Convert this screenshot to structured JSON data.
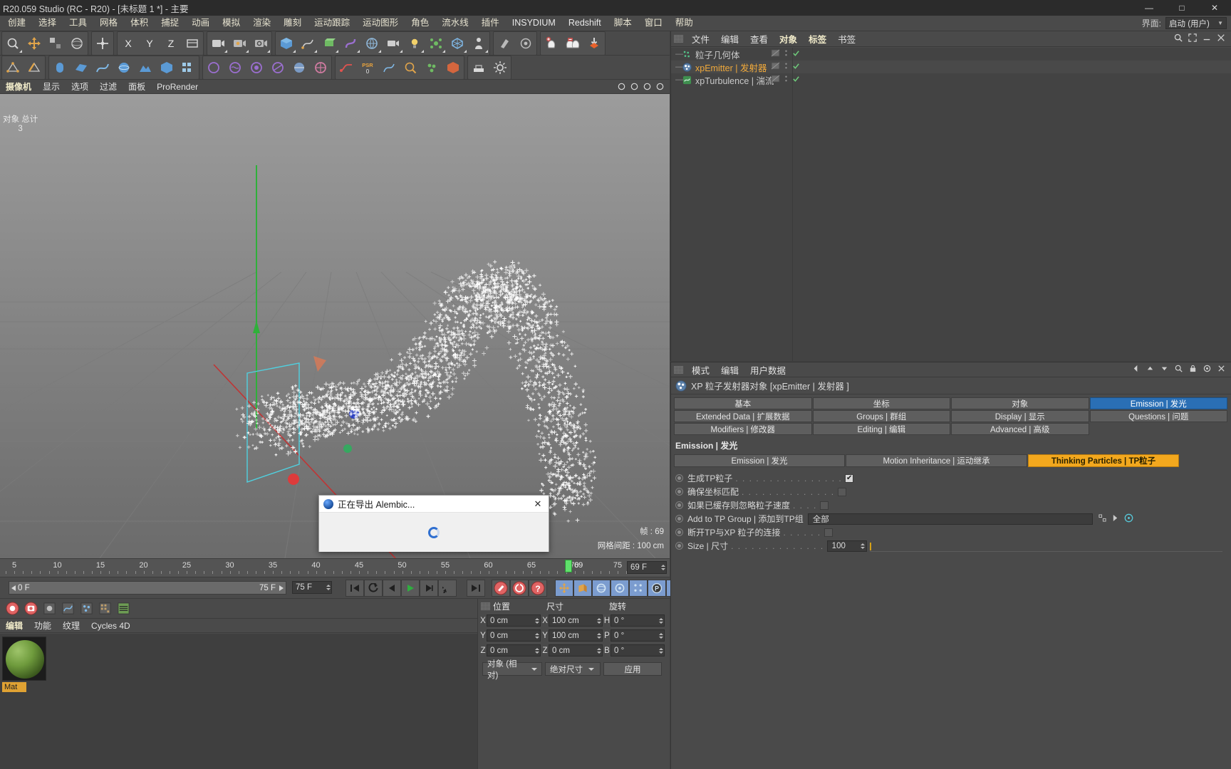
{
  "window": {
    "title": "R20.059 Studio (RC - R20) - [未标题 1 *] - 主要",
    "minimize": "—",
    "maximize": "□",
    "close": "✕"
  },
  "menubar": {
    "items": [
      "创建",
      "选择",
      "工具",
      "网格",
      "体积",
      "捕捉",
      "动画",
      "模拟",
      "渲染",
      "雕刻",
      "运动跟踪",
      "运动图形",
      "角色",
      "流水线",
      "插件",
      "INSYDIUM",
      "Redshift",
      "脚本",
      "窗口",
      "帮助"
    ],
    "layout_label": "界面:",
    "layout_value": "启动 (用户)"
  },
  "viewport": {
    "tabs": [
      "摄像机",
      "显示",
      "选项",
      "过滤",
      "面板",
      "ProRender"
    ],
    "active_tab": "摄像机",
    "hud_objects_label": "对象 总计",
    "hud_objects_count": "3",
    "hud_frame": "帧 : 69",
    "hud_grid": "网格间距 : 100 cm"
  },
  "timeline": {
    "ticks": [
      "5",
      "10",
      "15",
      "20",
      "25",
      "30",
      "35",
      "40",
      "45",
      "50",
      "55",
      "60",
      "65",
      "70",
      "75"
    ],
    "current_marker": "69",
    "current_field": "69 F"
  },
  "playbar": {
    "start_frame": "0 F",
    "end_frame_track": "75 F",
    "end_frame_field": "75 F"
  },
  "materials": {
    "tabs": [
      "编辑",
      "功能",
      "纹理",
      "Cycles 4D"
    ],
    "active_tab": "编辑",
    "material_name": "Mat"
  },
  "coordinates": {
    "columns": [
      "位置",
      "尺寸",
      "旋转"
    ],
    "rows": [
      {
        "axis1": "X",
        "v1": "0 cm",
        "axis2": "X",
        "v2": "100 cm",
        "axis3": "H",
        "v3": "0 °"
      },
      {
        "axis1": "Y",
        "v1": "0 cm",
        "axis2": "Y",
        "v2": "100 cm",
        "axis3": "P",
        "v3": "0 °"
      },
      {
        "axis1": "Z",
        "v1": "0 cm",
        "axis2": "Z",
        "v2": "0 cm",
        "axis3": "B",
        "v3": "0 °"
      }
    ],
    "mode_select": "对象 (相对)",
    "size_select": "绝对尺寸",
    "apply_button": "应用"
  },
  "object_manager": {
    "menu": [
      "文件",
      "编辑",
      "查看",
      "对象",
      "标签",
      "书签"
    ],
    "items": [
      {
        "name": "粒子几何体",
        "selected": false
      },
      {
        "name": "xpEmitter | 发射器",
        "selected": true
      },
      {
        "name": "xpTurbulence | 湍流",
        "selected": false
      }
    ]
  },
  "attribute_manager": {
    "menu": [
      "模式",
      "编辑",
      "用户数据"
    ],
    "object_title": "XP 粒子发射器对象 [xpEmitter | 发射器 ]",
    "tabs_row1": [
      "基本",
      "坐标",
      "对象",
      "Emission | 发光"
    ],
    "tabs_row2": [
      "Extended Data | 扩展数据",
      "Groups | 群组",
      "Display | 显示",
      "Questions | 问题"
    ],
    "tabs_row3": [
      "Modifiers | 修改器",
      "Editing | 编辑",
      "Advanced | 高级",
      ""
    ],
    "active_tab": "Emission | 发光",
    "section_label": "Emission | 发光",
    "subtabs": [
      "Emission | 发光",
      "Motion Inheritance | 运动继承",
      "Thinking Particles | TP粒子"
    ],
    "active_subtab": "Thinking Particles | TP粒子",
    "params": [
      {
        "label": "生成TP粒子",
        "type": "checkbox",
        "checked": true,
        "dots": ". . . . . . . . . . . . . . . ."
      },
      {
        "label": "确保坐标匹配",
        "type": "checkbox",
        "checked": false,
        "dots": ". . . . . . . . . . . . . ."
      },
      {
        "label": "如果已缓存则忽略粒子速度",
        "type": "checkbox",
        "checked": false,
        "dots": ". . . ."
      },
      {
        "label": "Add to TP Group | 添加到TP组",
        "type": "text",
        "value": "全部",
        "dots": ""
      },
      {
        "label": "断开TP与XP 粒子的连接",
        "type": "checkbox",
        "checked": false,
        "dots": ". . . . . ."
      },
      {
        "label": "Size | 尺寸",
        "type": "number",
        "value": "100",
        "dots": ". . . . . . . . . . . . . ."
      }
    ]
  },
  "dialog": {
    "title": "正在导出 Alembic...",
    "close": "✕"
  },
  "colors": {
    "accent_orange": "#f3a81e",
    "tab_blue": "#2a6fb5",
    "selected_text": "#f0a93b",
    "menu_text": "#e6e2cf"
  }
}
